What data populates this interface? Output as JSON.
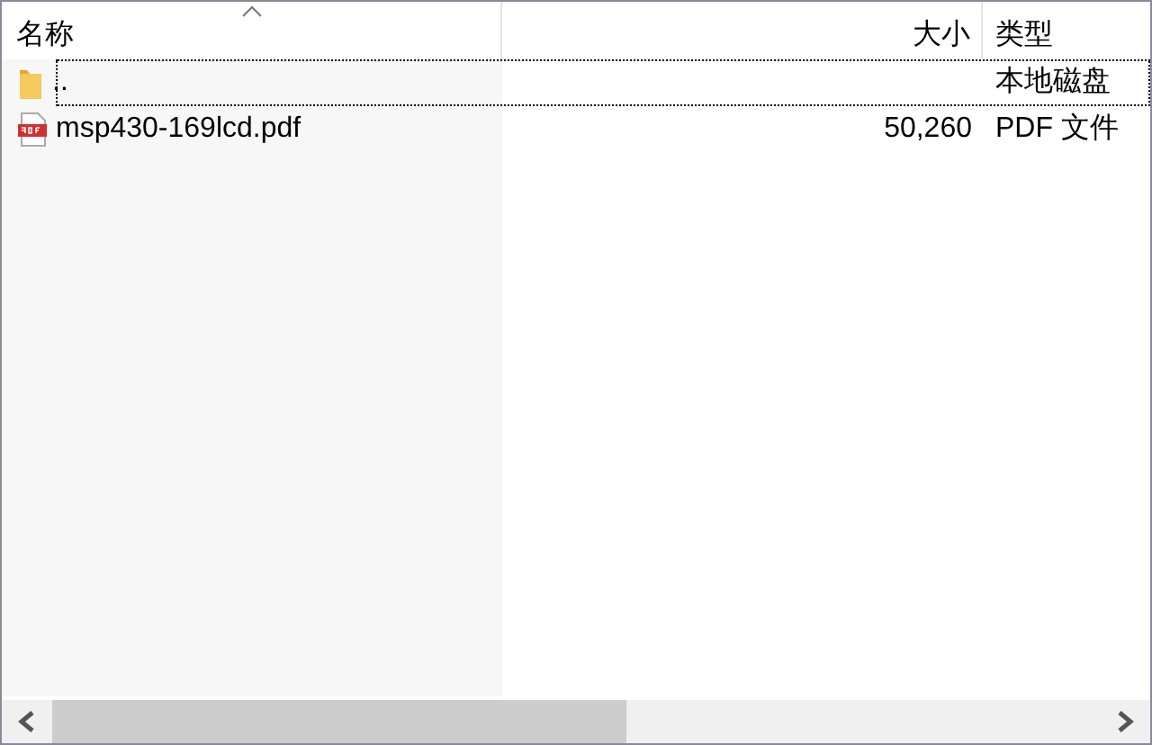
{
  "columns": [
    {
      "label": "名称",
      "sorted": true
    },
    {
      "label": "大小",
      "sorted": false
    },
    {
      "label": "类型",
      "sorted": false
    }
  ],
  "rows": [
    {
      "kind": "folder",
      "name": "..",
      "size": "",
      "type": "本地磁盘",
      "focused": true
    },
    {
      "kind": "pdf",
      "name": "msp430-169lcd.pdf",
      "size": "50,260",
      "type": "PDF 文件",
      "focused": false
    }
  ]
}
